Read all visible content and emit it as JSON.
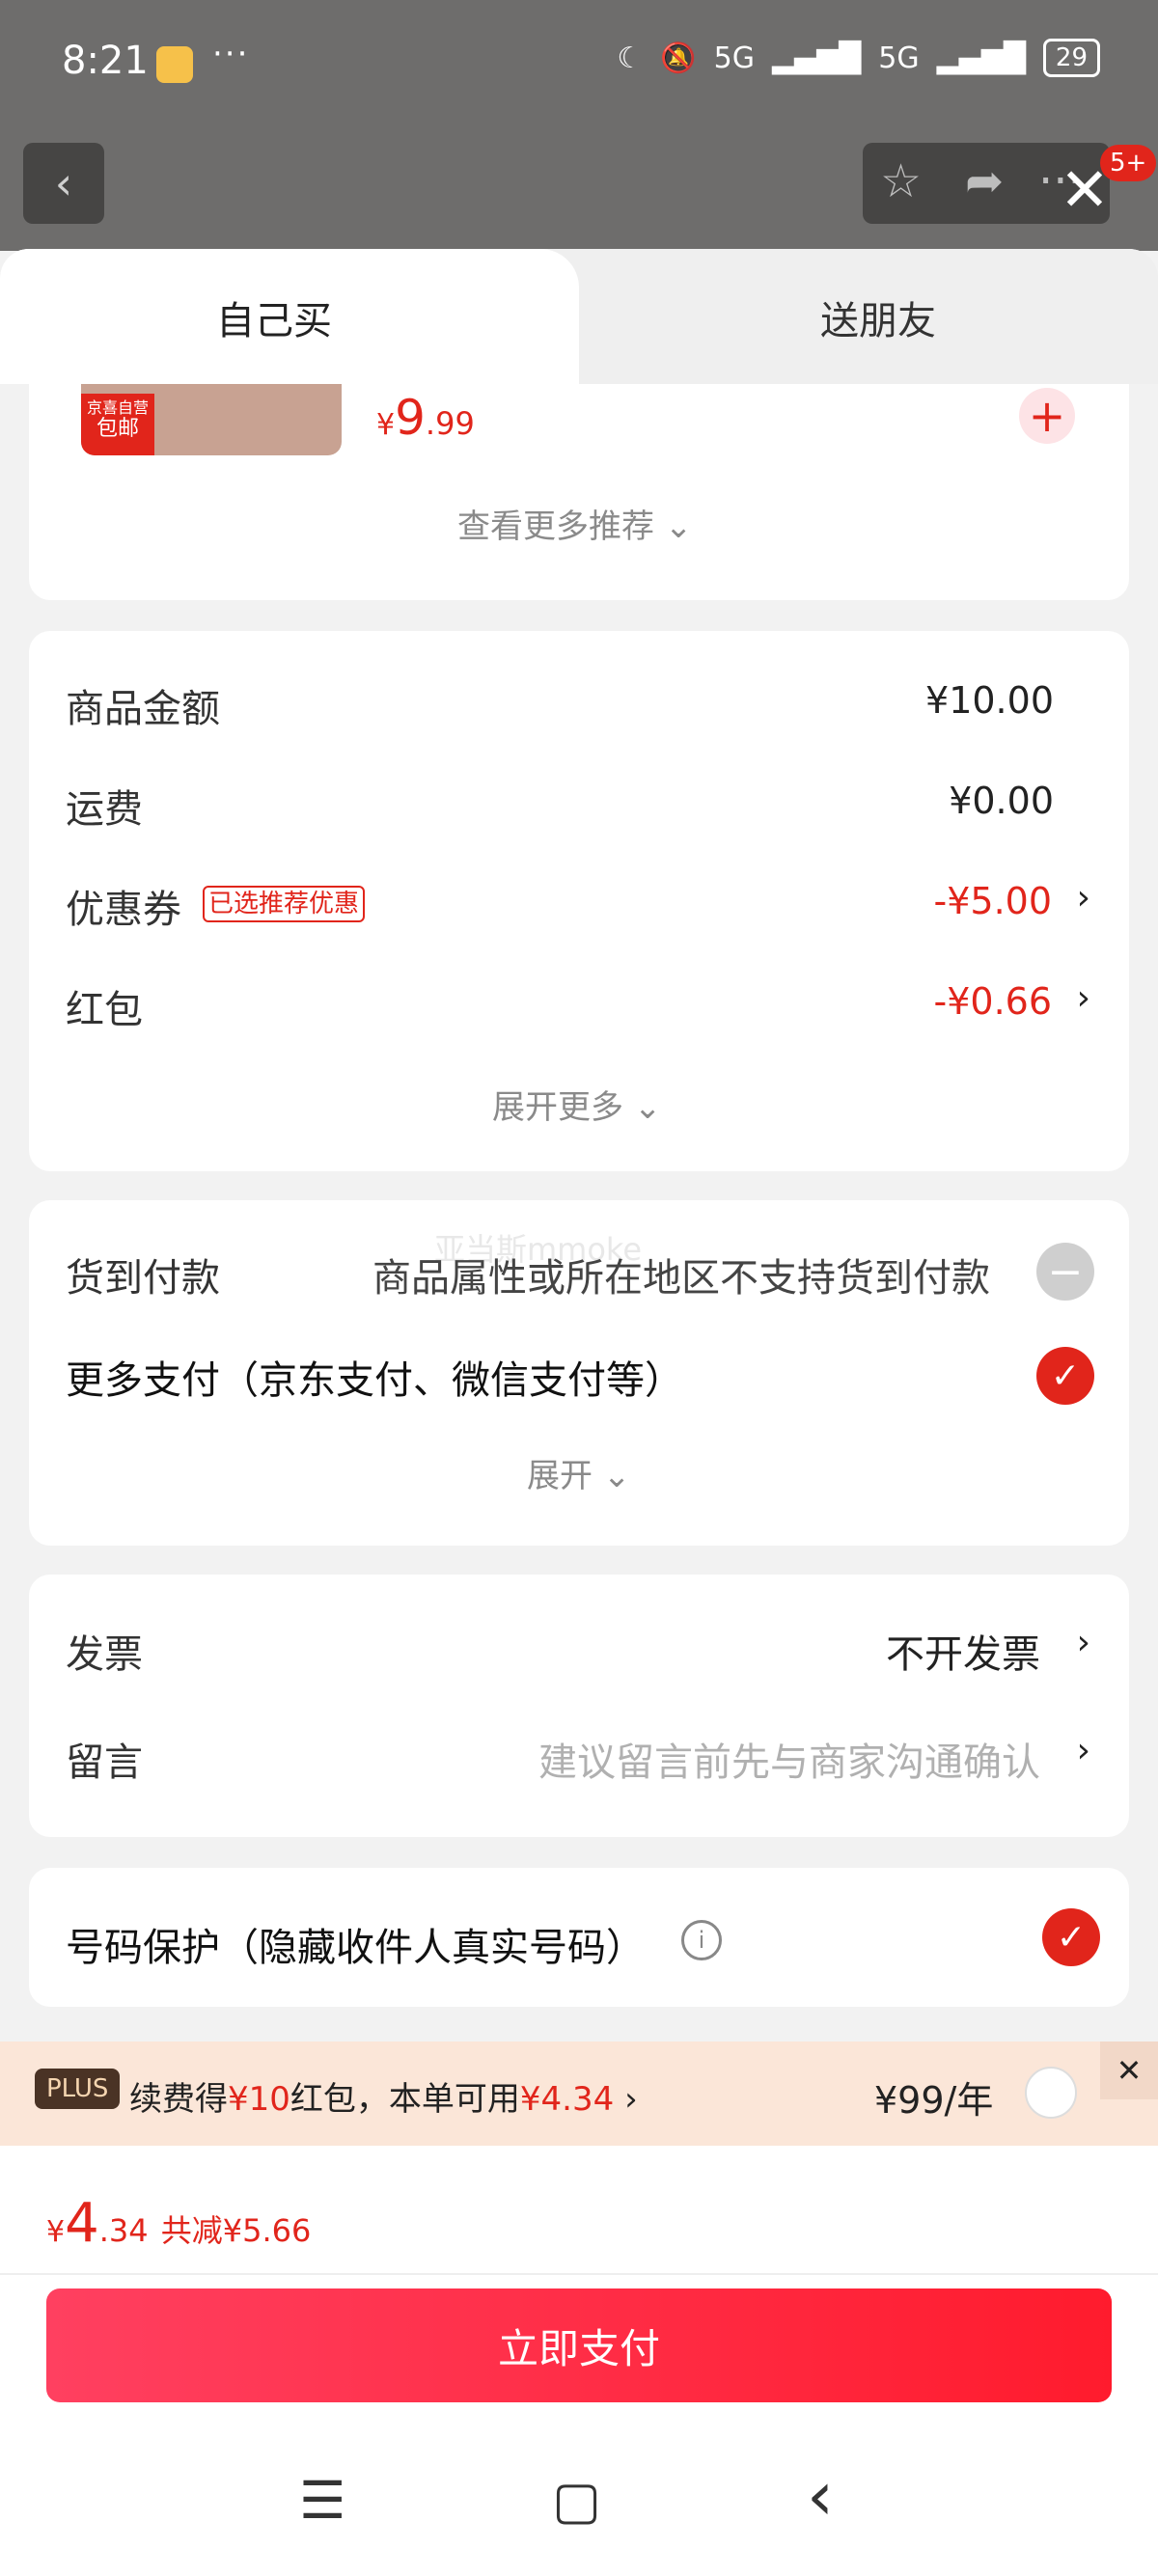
{
  "status_bar": {
    "time": "8:21",
    "more": "···",
    "net1": "5G",
    "net2": "5G",
    "battery": "29"
  },
  "header": {
    "back": "‹",
    "star": "☆",
    "share": "➦",
    "more": "···",
    "badge": "5+",
    "close": "✕"
  },
  "tabs": [
    {
      "label": "自己买"
    },
    {
      "label": "送朋友"
    }
  ],
  "recommend": {
    "tag_line1": "京喜自营",
    "tag_line2": "包邮",
    "price_symbol": "¥",
    "price_int": "9",
    "price_dec": ".99",
    "add": "+",
    "more_label": "查看更多推荐"
  },
  "summary": {
    "rows": [
      {
        "label": "商品金额",
        "value": "¥10.00"
      },
      {
        "label": "运费",
        "value": "¥0.00"
      },
      {
        "label": "优惠券",
        "tag": "已选推荐优惠",
        "value": "-¥5.00"
      },
      {
        "label": "红包",
        "value": "-¥0.66"
      }
    ],
    "expand_label": "展开更多"
  },
  "payment": {
    "cod_label": "货到付款",
    "cod_note": "商品属性或所在地区不支持货到付款",
    "more_label": "更多支付（京东支付、微信支付等）",
    "watermark": "亚当斯mmoke",
    "expand_label": "展开"
  },
  "invoice": {
    "label": "发票",
    "value": "不开发票",
    "memo_label": "留言",
    "memo_placeholder": "建议留言前先与商家沟通确认"
  },
  "privacy": {
    "label": "号码保护（隐藏收件人真实号码）",
    "info": "i"
  },
  "plus": {
    "chip": "PLUS",
    "text_a": "续费得",
    "amount_a": "¥10",
    "text_b": "红包，本单可用",
    "amount_b": "¥4.34",
    "arrow": "›",
    "price": "¥99/年",
    "close": "✕"
  },
  "total": {
    "symbol": "¥",
    "int": "4",
    "dec": ".34",
    "saved": "共减¥5.66"
  },
  "pay_button": "立即支付",
  "nav": {
    "menu": "☰",
    "home": "▢",
    "back": "‹"
  },
  "colors": {
    "accent": "#e1251b"
  }
}
